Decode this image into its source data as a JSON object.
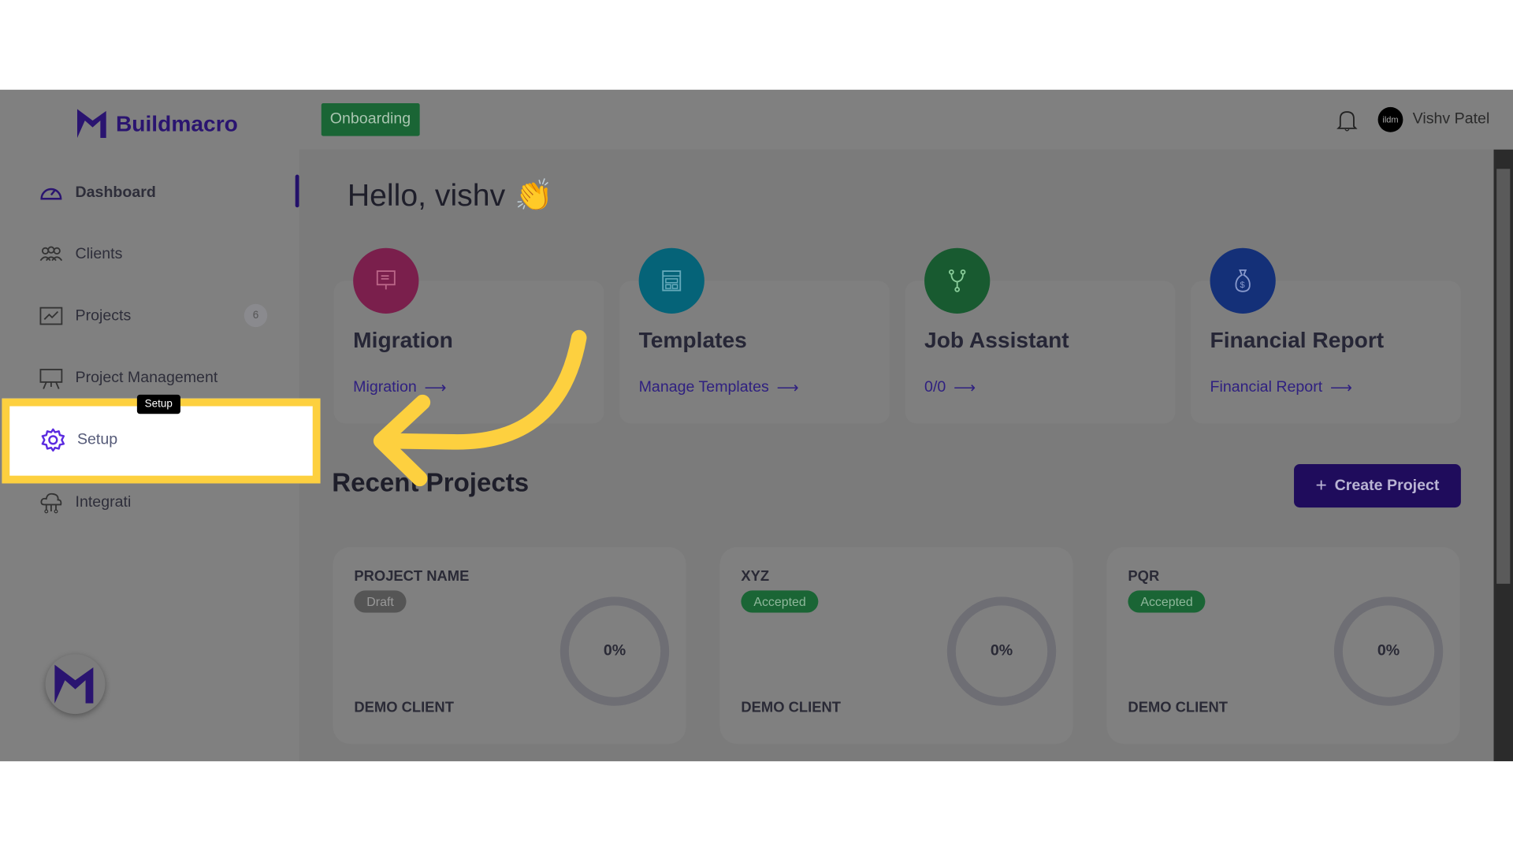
{
  "brand": {
    "name": "Buildmacro"
  },
  "sidebar": {
    "items": [
      {
        "label": "Dashboard",
        "icon": "gauge-icon"
      },
      {
        "label": "Clients",
        "icon": "users-icon"
      },
      {
        "label": "Projects",
        "icon": "chart-icon",
        "badge": "6"
      },
      {
        "label": "Project Management",
        "icon": "presentation-icon"
      },
      {
        "label": "Setup",
        "icon": "gear-icon"
      },
      {
        "label": "Integrati",
        "icon": "cloud-network-icon"
      }
    ],
    "tooltip": "Setup"
  },
  "header": {
    "onboarding": "Onboarding",
    "user": "Vishv Patel",
    "avatar_text": "ildm"
  },
  "main": {
    "greeting": "Hello, vishv",
    "greeting_emoji": "👏",
    "features": [
      {
        "title": "Migration",
        "link": "Migration",
        "color": "#7a1f4c"
      },
      {
        "title": "Templates",
        "link": "Manage Templates",
        "color": "#056378"
      },
      {
        "title": "Job Assistant",
        "link": "0/0",
        "color": "#185a30"
      },
      {
        "title": "Financial Report",
        "link": "Financial Report",
        "color": "#143078"
      }
    ],
    "recent_title": "Recent Projects",
    "create_label": "Create Project",
    "projects": [
      {
        "name": "PROJECT NAME",
        "status": "Draft",
        "client": "DEMO CLIENT",
        "progress": "0%"
      },
      {
        "name": "XYZ",
        "status": "Accepted",
        "client": "DEMO CLIENT",
        "progress": "0%"
      },
      {
        "name": "PQR",
        "status": "Accepted",
        "client": "DEMO CLIENT",
        "progress": "0%"
      }
    ]
  },
  "colors": {
    "highlight": "#fdd03f",
    "accent": "#1f0c5c",
    "success": "#1a6535"
  }
}
